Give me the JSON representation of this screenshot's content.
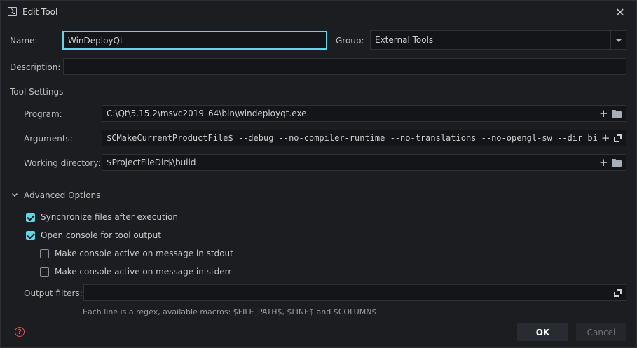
{
  "window": {
    "title": "Edit Tool",
    "app_icon": "terminal-icon",
    "close_icon": "close-icon",
    "close_glyph": "✕"
  },
  "form": {
    "name_label": "Name:",
    "name_value": "WinDeployQt",
    "group_label": "Group:",
    "group_value": "External Tools",
    "description_label": "Description:",
    "description_value": ""
  },
  "tool_settings": {
    "heading": "Tool Settings",
    "program_label": "Program:",
    "program_value": "C:\\Qt\\5.15.2\\msvc2019_64\\bin\\windeployqt.exe",
    "arguments_label": "Arguments:",
    "arguments_value": "$CMakeCurrentProductFile$ --debug --no-compiler-runtime --no-translations --no-opengl-sw --dir bin/",
    "working_dir_label": "Working directory:",
    "working_dir_value": "$ProjectFileDir$\\build",
    "plus_glyph": "+"
  },
  "advanced": {
    "heading": "Advanced Options",
    "expanded": true,
    "options": [
      {
        "label": "Synchronize files after execution",
        "checked": true
      },
      {
        "label": "Open console for tool output",
        "checked": true
      },
      {
        "label": "Make console active on message in stdout",
        "checked": false
      },
      {
        "label": "Make console active on message in stderr",
        "checked": false
      }
    ],
    "output_filters_label": "Output filters:",
    "output_filters_value": "",
    "hint": "Each line is a regex, available macros: $FILE_PATH$, $LINE$ and $COLUMN$"
  },
  "footer": {
    "help_glyph": "?",
    "ok_label": "OK",
    "cancel_label": "Cancel"
  },
  "colors": {
    "accent": "#5fd7e6",
    "background": "#1b1d21",
    "help": "#e0565b"
  }
}
